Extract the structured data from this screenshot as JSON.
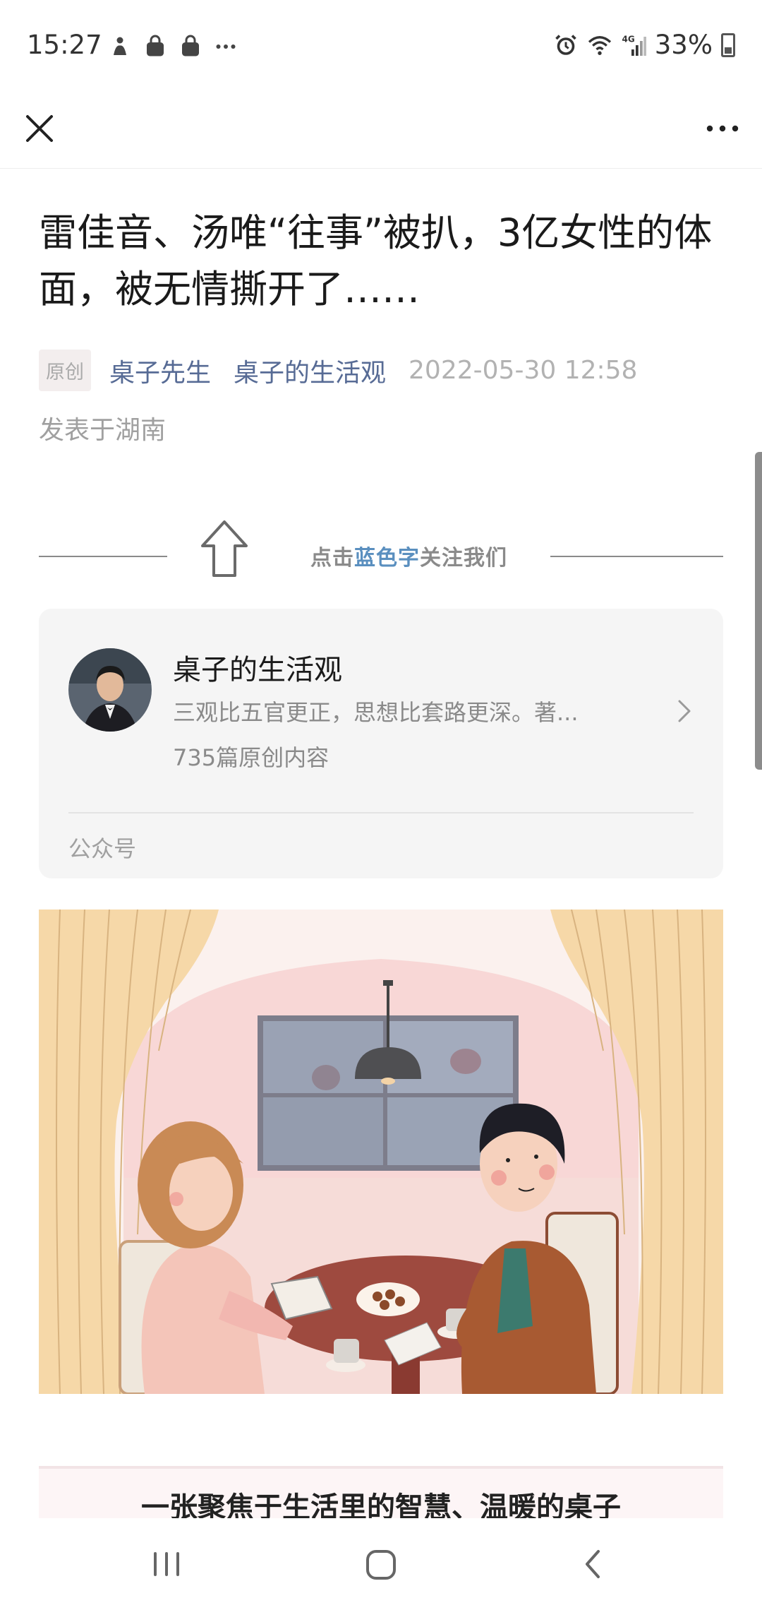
{
  "status_bar": {
    "time": "15:27",
    "left_icons": [
      "notification-icon",
      "shopping-bag-icon",
      "shopping-bag-icon",
      "more-notifications-icon"
    ],
    "right_icons": [
      "alarm-icon",
      "wifi-icon",
      "signal-4g-icon"
    ],
    "battery": "33%"
  },
  "top_bar": {
    "close_icon": "close-icon",
    "more_icon": "more-horizontal-icon"
  },
  "article": {
    "title": "雷佳音、汤唯“往事”被扒，3亿女性的体面，被无情撕开了……",
    "badge": "原创",
    "author": "桌子先生",
    "account": "桌子的生活观",
    "datetime": "2022-05-30 12:58",
    "location": "发表于湖南"
  },
  "follow_banner": {
    "prefix": "点击",
    "highlight": "蓝色字",
    "suffix": "关注我们"
  },
  "account_card": {
    "name": "桌子的生活观",
    "description": "三观比五官更正，思想比套路更深。著...",
    "count": "735篇原创内容",
    "type": "公众号"
  },
  "caption": {
    "text": "一张聚焦于生活里的智慧、温暖的桌子"
  },
  "nav_bar": {
    "recents": "recents-icon",
    "home": "home-icon",
    "back": "back-icon"
  },
  "colors": {
    "link": "#576b95",
    "meta_gray": "#b2b2b2",
    "card_bg": "#f5f5f5"
  }
}
